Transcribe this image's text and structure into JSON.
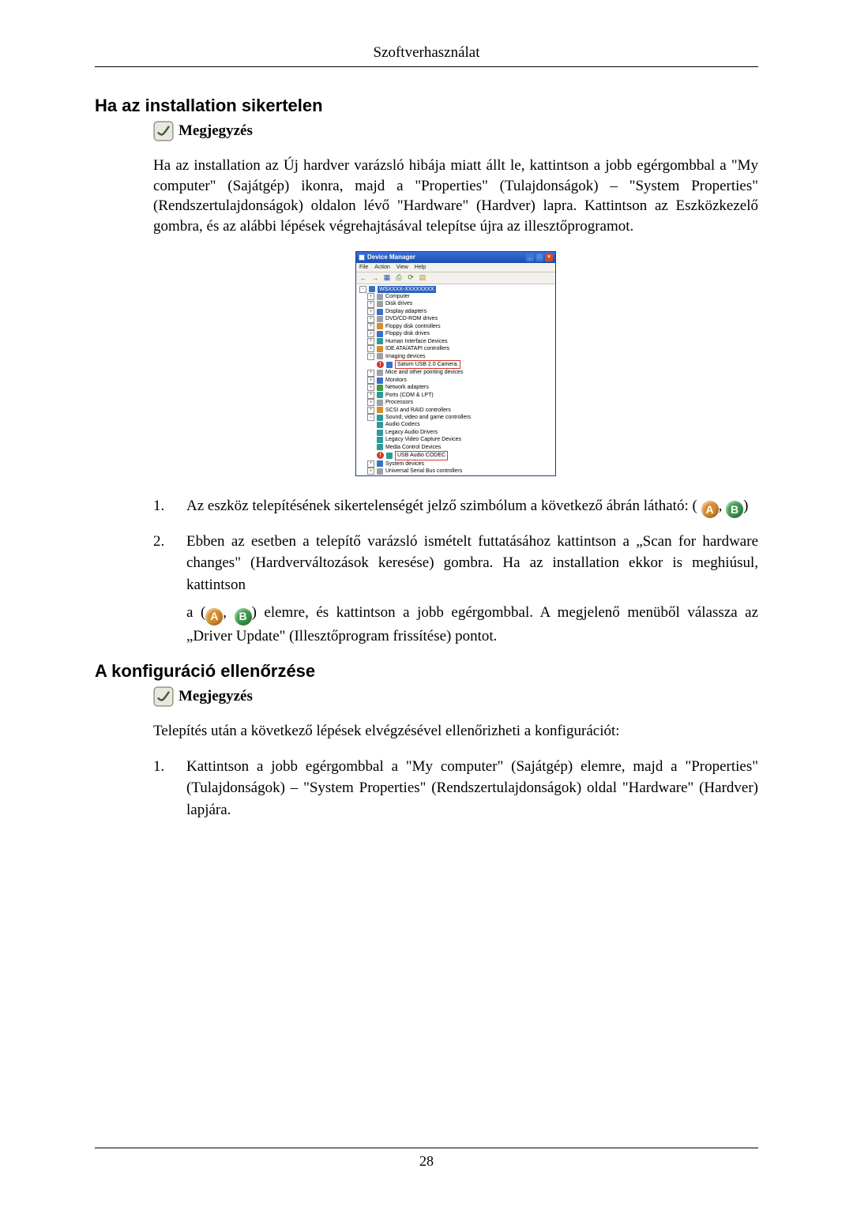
{
  "header": {
    "title": "Szoftverhasználat"
  },
  "section1": {
    "heading": "Ha az installation sikertelen",
    "note_label": "Megjegyzés",
    "intro": "Ha az installation az Új hardver varázsló hibája miatt állt le, kattintson a jobb egérgombbal a \"My computer\" (Sajátgép) ikonra, majd a \"Properties\" (Tulajdonságok) – \"System Properties\" (Rendszertulajdonságok) oldalon lévő \"Hardware\" (Hardver) lapra. Kattintson az Eszközkezelő gombra, és az alábbi lépések végrehajtásával telepítse újra az illesztőprogramot."
  },
  "devmgr": {
    "title": "Device Manager",
    "menu": {
      "file": "File",
      "action": "Action",
      "view": "View",
      "help": "Help"
    },
    "root": "WSXXXX-XXXXXXXX",
    "nodes": {
      "computer": "Computer",
      "diskdrives": "Disk drives",
      "display": "Display adapters",
      "dvd": "DVD/CD-ROM drives",
      "floppyctrl": "Floppy disk controllers",
      "floppydrv": "Floppy disk drives",
      "hid": "Human Interface Devices",
      "ide": "IDE ATA/ATAPI controllers",
      "imaging": "Imaging devices",
      "saturn": "Saturn USB 2.0 Camera.",
      "mice": "Mice and other pointing devices",
      "monitors": "Monitors",
      "network": "Network adapters",
      "ports": "Ports (COM & LPT)",
      "processors": "Processors",
      "scsi": "SCSI and RAID controllers",
      "sound": "Sound, video and game controllers",
      "audiocodecs": "Audio Codecs",
      "legacyaudio": "Legacy Audio Drivers",
      "legacyvideo": "Legacy Video Capture Devices",
      "mediactrl": "Media Control Devices",
      "usbaudio": "USB Audio CODEC",
      "systemdev": "System devices",
      "usbctrl": "Universal Serial Bus controllers"
    }
  },
  "steps1": {
    "s1_pre": "Az eszköz telepítésének sikertelenségét jelző szimbólum a következő ábrán látható: (",
    "s1_mid": ", ",
    "s1_post": ")",
    "s2_p1": "Ebben az esetben a telepítő varázsló ismételt futtatásához kattintson a „Scan for hardware changes\" (Hardverváltozások keresése) gombra. Ha az installation ekkor is meghiúsul, kattintson",
    "s2_p2_pre": "a (",
    "s2_p2_mid": ", ",
    "s2_p2_post": ") elemre, és kattintson a jobb egérgombbal. A megjelenő menüből válassza az „Driver Update\" (Illesztőprogram frissítése) pontot."
  },
  "section2": {
    "heading": "A konfiguráció ellenőrzése",
    "note_label": "Megjegyzés",
    "intro": "Telepítés után a következő lépések elvégzésével ellenőrizheti a konfigurációt:"
  },
  "steps2": {
    "s1": "Kattintson a jobb egérgombbal a \"My computer\" (Sajátgép) elemre, majd a \"Properties\" (Tulajdonságok) – \"System Properties\" (Rendszertulajdonságok) oldal \"Hardware\" (Hardver) lapjára."
  },
  "badges": {
    "a": "A",
    "b": "B"
  },
  "footer": {
    "page": "28"
  }
}
